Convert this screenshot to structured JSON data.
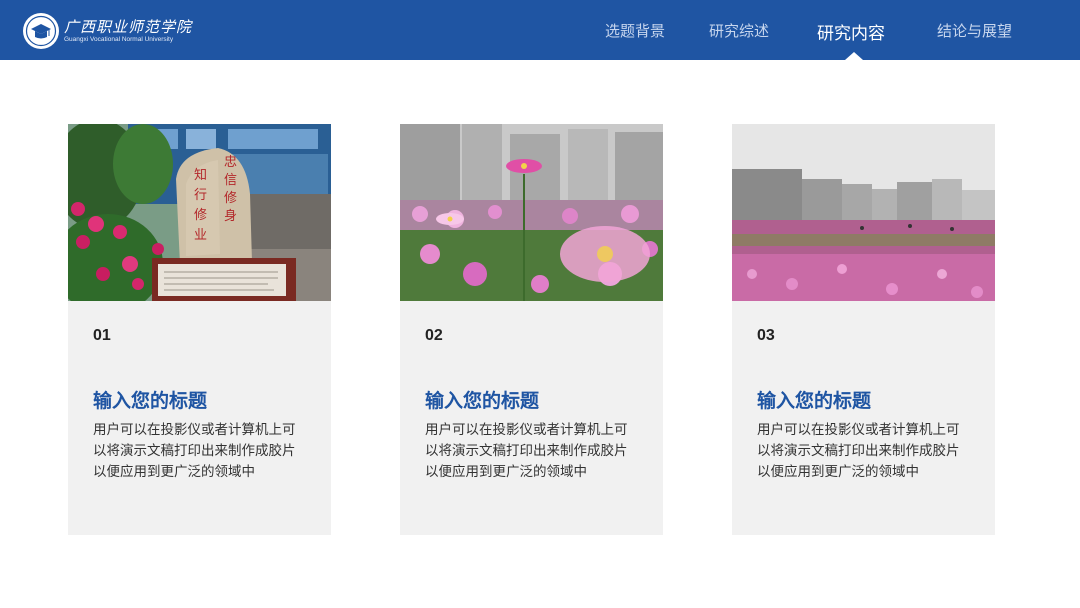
{
  "header": {
    "logo_title": "广西职业师范学院",
    "logo_subtitle": "Guangxi Vocational Normal University"
  },
  "nav": {
    "items": [
      {
        "label": "选题背景",
        "active": false
      },
      {
        "label": "研究综述",
        "active": false
      },
      {
        "label": "研究内容",
        "active": true
      },
      {
        "label": "结论与展望",
        "active": false
      }
    ]
  },
  "photo_text": {
    "stone_inscription": "忠信修身 知行修业"
  },
  "cards": [
    {
      "number": "01",
      "title": "输入您的标题",
      "body": "用户可以在投影仪或者计算机上可以将演示文稿打印出来制作成胶片以便应用到更广泛的领域中"
    },
    {
      "number": "02",
      "title": "输入您的标题",
      "body": "用户可以在投影仪或者计算机上可以将演示文稿打印出来制作成胶片以便应用到更广泛的领域中"
    },
    {
      "number": "03",
      "title": "输入您的标题",
      "body": "用户可以在投影仪或者计算机上可以将演示文稿打印出来制作成胶片以便应用到更广泛的领域中"
    }
  ],
  "colors": {
    "header_bg": "#1f55a3",
    "title_blue": "#1f55a3",
    "card_bg": "#f1f1f1"
  }
}
